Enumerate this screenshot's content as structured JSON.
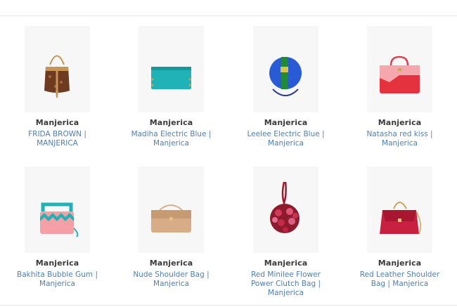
{
  "products": [
    {
      "brand": "Manjerica",
      "title": "FRIDA BROWN | MANJERICA",
      "image_icon": "bucket-bag-brown-icon"
    },
    {
      "brand": "Manjerica",
      "title": "Madiha Electric Blue | Manjerica",
      "image_icon": "clutch-teal-icon"
    },
    {
      "brand": "Manjerica",
      "title": "Leelee Electric Blue | Manjerica",
      "image_icon": "round-bag-blue-icon"
    },
    {
      "brand": "Manjerica",
      "title": "Natasha red kiss | Manjerica",
      "image_icon": "tote-red-pink-icon"
    },
    {
      "brand": "Manjerica",
      "title": "Bakhita Bubble Gum | Manjerica",
      "image_icon": "wave-bag-pink-teal-icon"
    },
    {
      "brand": "Manjerica",
      "title": "Nude Shoulder Bag | Manjerica",
      "image_icon": "shoulder-bag-nude-icon"
    },
    {
      "brand": "Manjerica",
      "title": "Red Minilee Flower Power Clutch Bag | Manjerica",
      "image_icon": "flower-clutch-red-icon"
    },
    {
      "brand": "Manjerica",
      "title": "Red Leather Shoulder Bag | Manjerica",
      "image_icon": "shoulder-bag-red-icon"
    }
  ]
}
